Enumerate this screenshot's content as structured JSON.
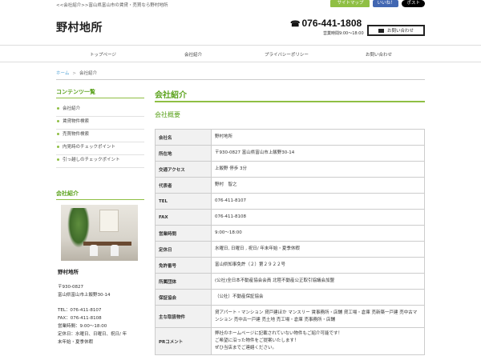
{
  "header": {
    "tagline": "<<会社紹介>>富山県富山市の賃貸・売買なら野村地所",
    "sitemap_label": "サイトマップ",
    "like_label": "いいね！",
    "post_label": "ポスト",
    "logo": "野村地所",
    "phone": "076-441-1808",
    "hours": "営業時間9:00～18:00",
    "contact_label": "お問い合わせ"
  },
  "nav": {
    "items": [
      "トップページ",
      "会社紹介",
      "プライバシーポリシー",
      "お問い合わせ"
    ]
  },
  "breadcrumb": {
    "home": "ホーム",
    "separator": ">",
    "current": "会社紹介"
  },
  "sidebar": {
    "contents_heading": "コンテンツ一覧",
    "items": [
      "会社紹介",
      "賃貸物件検索",
      "売買物件検索",
      "内見時のチェックポイント",
      "引っ越しのチェックポイント"
    ],
    "company_heading": "会社紹介",
    "office_name": "野村地所",
    "postal": "〒930-0827",
    "address": "富山県富山市上飯野30-14",
    "tel": "TEL：076-411-8107",
    "fax": "FAX：076-411-8108",
    "hours": "営業時間：9:00～18:00",
    "holiday_1": "定休日：水曜日、日曜日、祝日/ 年",
    "holiday_2": "末年始・夏季休暇"
  },
  "main": {
    "title": "会社紹介",
    "subtitle": "会社概要",
    "rows": [
      {
        "k": "会社名",
        "v": "野村地所"
      },
      {
        "k": "所在地",
        "v": "〒930-0827 富山県富山市上飯野30-14"
      },
      {
        "k": "交通アクセス",
        "v": "上飯野 停歩 3分"
      },
      {
        "k": "代表者",
        "v": "野村　智之"
      },
      {
        "k": "TEL",
        "v": "076-411-8107"
      },
      {
        "k": "FAX",
        "v": "076-411-8108"
      },
      {
        "k": "営業時間",
        "v": "9:00～18:00"
      },
      {
        "k": "定休日",
        "v": "水曜日, 日曜日 , 祝日/ 年末年始・夏季休暇"
      },
      {
        "k": "免許番号",
        "v": "富山県知事免許（２）第２９２２号"
      },
      {
        "k": "所属団体",
        "v": "(公社)全日本不動産協会会員 北陸不動産公正取引協議会加盟"
      },
      {
        "k": "保証協会",
        "v": "（公社）不動産保証協会"
      },
      {
        "k": "主な取扱物件",
        "v": "貸アパート・マンション 貸戸建ほか マンスリー 賃事務所・店舗 貸工場・倉庫 売新築一戸建 売中古マンション 売中古一戸建 売土地 売工場・倉庫 売事務所・店舗"
      },
      {
        "k": "PRコメント",
        "v": "弊社のホームページに記載されていない物件もご紹介可能です！\nご希望に沿った物件をご提案いたします！\nぜひ当店までご連絡ください。"
      }
    ]
  }
}
